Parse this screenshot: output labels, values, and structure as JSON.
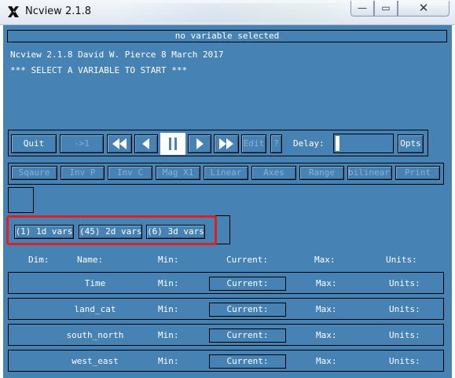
{
  "window": {
    "title": "Ncview 2.1.8",
    "minimize_glyph": "—",
    "maximize_glyph": "▭",
    "close_glyph": "✕"
  },
  "status": {
    "variable_label": "no variable selected",
    "info_line_1": "Ncview 2.1.8 David W. Pierce  8 March 2017",
    "info_line_2": "*** SELECT A VARIABLE TO START ***"
  },
  "toolbar": {
    "quit_label": "Quit",
    "goto_label": "->1",
    "edit_label": "Edit",
    "question_label": "?",
    "delay_label": "Delay:",
    "opts_label": "Opts",
    "icons": [
      "rewind-fast-icon",
      "step-back-icon",
      "pause-icon",
      "step-forward-icon",
      "fast-forward-icon"
    ]
  },
  "options_bar": {
    "items": [
      "Sqaure",
      "Inv P",
      "Inv C",
      "Mag X1",
      "Linear",
      "Axes",
      "Range",
      "bilinear_ty",
      "Print"
    ]
  },
  "var_groups": {
    "items": [
      "(1) 1d vars",
      "(45) 2d vars",
      "(6) 3d vars"
    ]
  },
  "dims_header": {
    "dim": "Dim:",
    "name": "Name:",
    "min": "Min:",
    "current": "Current:",
    "max": "Max:",
    "units": "Units:"
  },
  "dims": [
    {
      "name": "Time",
      "min": "Min:",
      "current": "Current:",
      "max": "Max:",
      "units": "Units:"
    },
    {
      "name": "land_cat",
      "min": "Min:",
      "current": "Current:",
      "max": "Max:",
      "units": "Units:"
    },
    {
      "name": "south_north",
      "min": "Min:",
      "current": "Current:",
      "max": "Max:",
      "units": "Units:"
    },
    {
      "name": "west_east",
      "min": "Min:",
      "current": "Current:",
      "max": "Max:",
      "units": "Units:"
    }
  ],
  "colors": {
    "panel": "#4682b4",
    "highlight": "#e02020"
  }
}
